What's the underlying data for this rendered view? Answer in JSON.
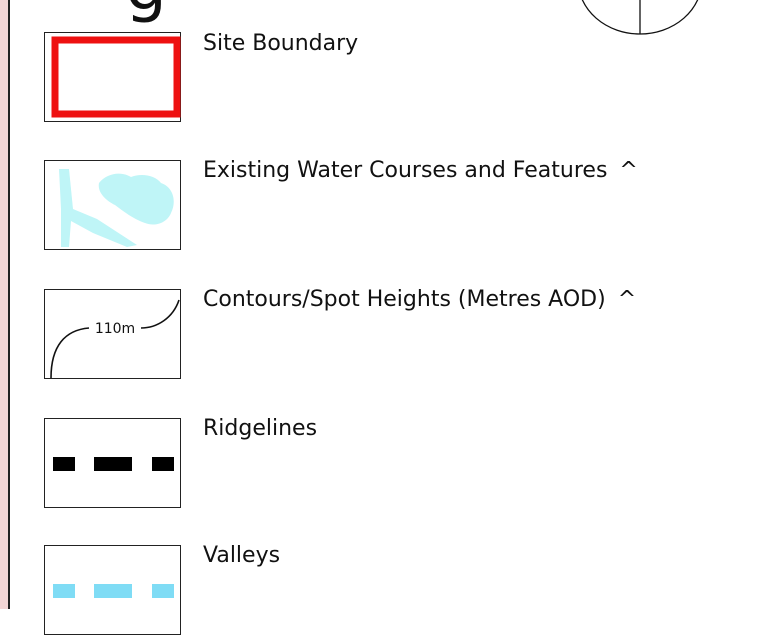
{
  "legend": {
    "items": [
      {
        "label": "Site Boundary",
        "symbol": "red-rectangle-outline",
        "color": "#ee1111"
      },
      {
        "label": "Existing Water Courses and Features",
        "note": "^",
        "symbol": "water-fill",
        "color": "#bff5f7"
      },
      {
        "label": "Contours/Spot Heights (Metres AOD)",
        "note": "^",
        "symbol": "contour-line",
        "contour_sample": "110m"
      },
      {
        "label": "Ridgelines",
        "symbol": "black-dashed-line",
        "color": "#000000"
      },
      {
        "label": "Valleys",
        "symbol": "light-blue-dashed-line",
        "color": "#7fdcf5"
      }
    ]
  },
  "title_fragment": "g"
}
